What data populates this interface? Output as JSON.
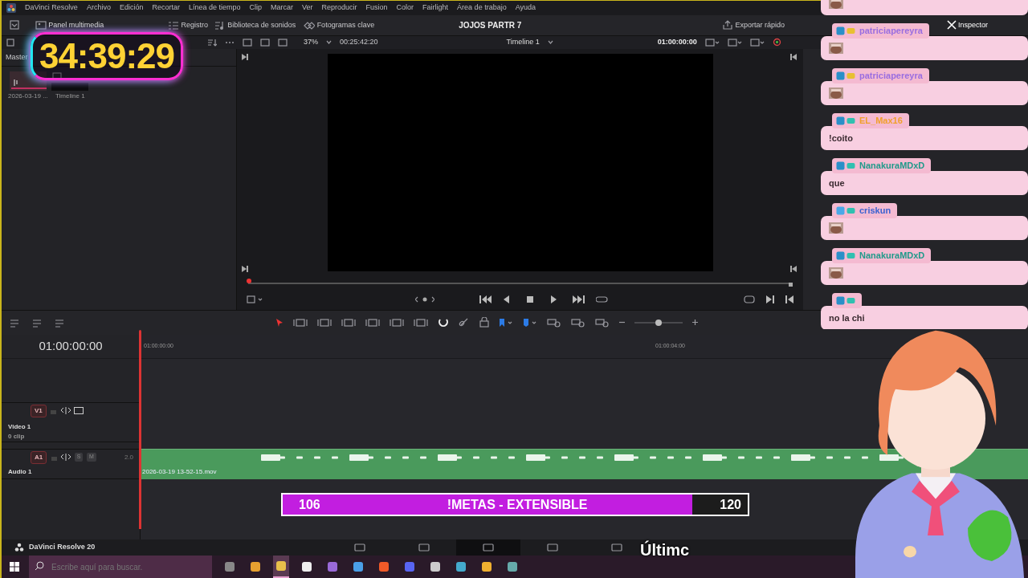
{
  "menu_bar": {
    "app_name": "DaVinci Resolve",
    "items": [
      "Archivo",
      "Edición",
      "Recortar",
      "Línea de tiempo",
      "Clip",
      "Marcar",
      "Ver",
      "Reproducir",
      "Fusion",
      "Color",
      "Fairlight",
      "Área de trabajo",
      "Ayuda"
    ]
  },
  "toolbar": {
    "panels": [
      "Panel multimedia",
      "Registro",
      "Biblioteca de sonidos",
      "Fotogramas clave"
    ],
    "project_title": "JOJOS PARTR 7",
    "export_label": "Exportar rápido",
    "inspector_label": "Inspector"
  },
  "viewer": {
    "zoom": "37%",
    "source_timecode": "00:25:42:20",
    "timeline_name": "Timeline 1",
    "timecode": "01:00:00:00"
  },
  "media_pool": {
    "bin": "Master",
    "items": [
      {
        "kind": "audio",
        "label": "2026-03-19 ..."
      },
      {
        "kind": "timeline",
        "label": "Timeline 1"
      }
    ]
  },
  "timeline": {
    "timecode": "01:00:00:00",
    "ruler": [
      "01:00:00:00",
      "01:00:04:00"
    ],
    "zoom_slider": {
      "level": 0.5
    },
    "tracks": [
      {
        "kind": "video",
        "tag": "V1",
        "name": "Video 1",
        "info": "0 clip"
      },
      {
        "kind": "audio",
        "tag": "A1",
        "name": "Audio 1",
        "solo": "S",
        "mute": "M",
        "channels": "2.0",
        "clip": "2026-03-19 13-52-15.mov"
      }
    ]
  },
  "page_bar": {
    "app_version": "DaVinci Resolve 20"
  },
  "taskbar": {
    "search_placeholder": "Escribe aquí para buscar."
  },
  "overlay": {
    "timer": "34:39:29",
    "goal": {
      "current": "106",
      "title": "!METAS - EXTENSIBLE",
      "target": "120",
      "level": 0.88
    },
    "caption": "Últimc",
    "chat": [
      {
        "kind": "emote"
      },
      {
        "kind": "emote",
        "user": "patriciapereyra",
        "color": "#9a6ee0"
      },
      {
        "kind": "emote",
        "user": "patriciapereyra",
        "color": "#9a6ee0"
      },
      {
        "kind": "text",
        "user": "EL_Max16",
        "color": "#f0a02c",
        "text": "!coito"
      },
      {
        "kind": "text",
        "user": "NanakuraMDxD",
        "color": "#1f9a8a",
        "text": "que"
      },
      {
        "kind": "emote",
        "user": "criskun",
        "color": "#3b62d0"
      },
      {
        "kind": "emote",
        "user": "NanakuraMDxD",
        "color": "#1f9a8a"
      },
      {
        "kind": "text",
        "text": "no la chi"
      }
    ]
  }
}
